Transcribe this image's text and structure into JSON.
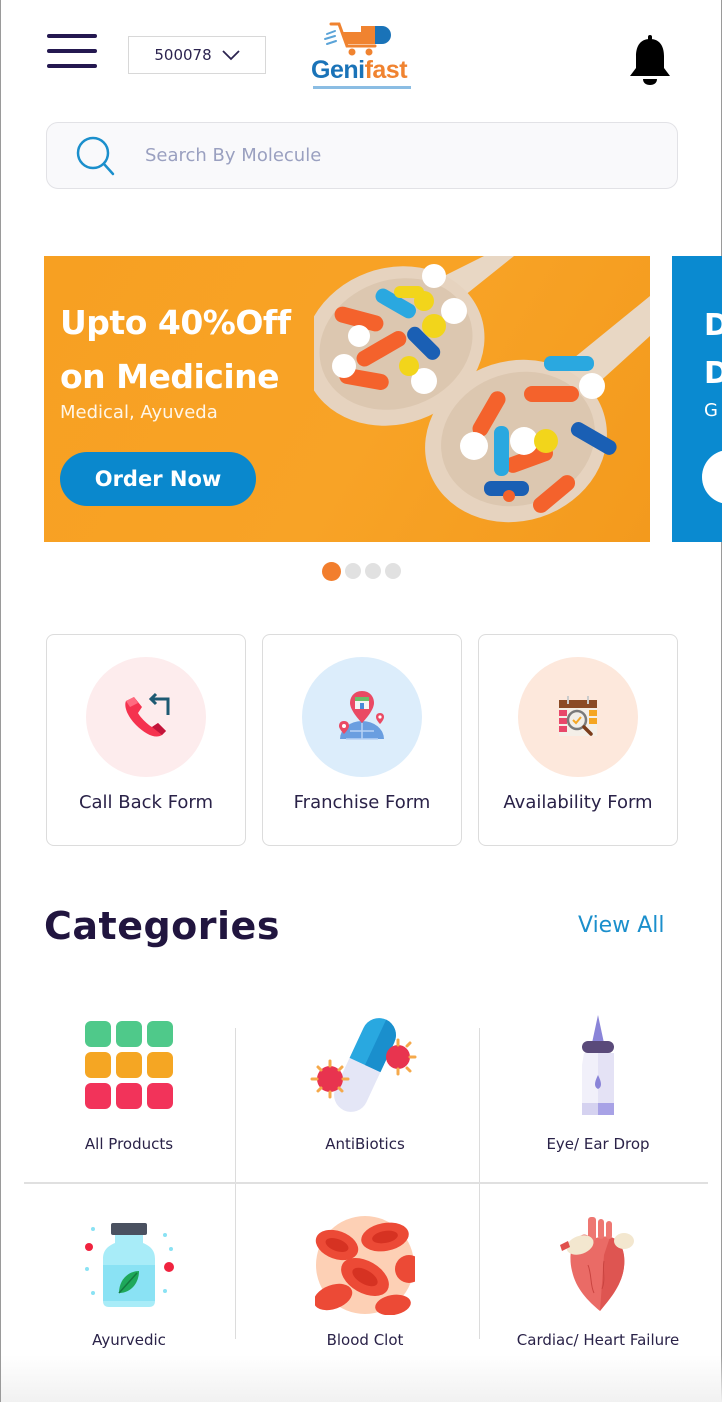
{
  "header": {
    "pincode": "500078",
    "logo": {
      "primary": "Geni",
      "secondary": "fast"
    }
  },
  "search": {
    "placeholder": "Search By Molecule",
    "value": ""
  },
  "banner": {
    "title": "Upto 40%Off\non Medicine",
    "subtitle": "Medical, Ayuveda",
    "cta_label": "Order Now",
    "next_banner": {
      "line1": "D",
      "line2": "D",
      "subtitle": "G"
    },
    "colors": {
      "background": "#f7a022",
      "cta": "#0a88cd",
      "next_background": "#0a8ad0"
    }
  },
  "carousel": {
    "total": 4,
    "active_index": 0,
    "active_color": "#f27e2d"
  },
  "forms": [
    {
      "label": "Call Back Form",
      "icon": "phone-callback-icon",
      "bg": "#fdeced"
    },
    {
      "label": "Franchise Form",
      "icon": "franchise-location-icon",
      "bg": "#dcedfb"
    },
    {
      "label": "Availability Form",
      "icon": "calendar-search-icon",
      "bg": "#fde8dc"
    }
  ],
  "categories": {
    "title": "Categories",
    "view_all_label": "View All",
    "items": [
      {
        "label": "All Products",
        "icon": "grid-icon"
      },
      {
        "label": "AntiBiotics",
        "icon": "capsule-bacteria-icon"
      },
      {
        "label": "Eye/ Ear Drop",
        "icon": "dropper-bottle-icon"
      },
      {
        "label": "Ayurvedic",
        "icon": "herbal-bottle-icon"
      },
      {
        "label": "Blood Clot",
        "icon": "blood-cells-icon"
      },
      {
        "label": "Cardiac/ Heart Failure",
        "icon": "heart-icon"
      }
    ]
  }
}
